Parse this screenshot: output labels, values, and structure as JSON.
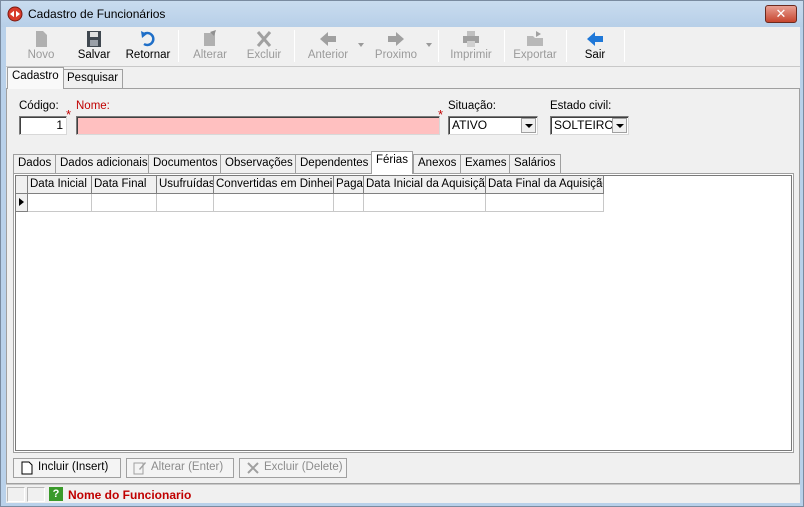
{
  "window": {
    "title": "Cadastro de Funcionários",
    "close_label": "✕"
  },
  "toolbar": {
    "novo": "Novo",
    "salvar": "Salvar",
    "retornar": "Retornar",
    "alterar": "Alterar",
    "excluir": "Excluir",
    "anterior": "Anterior",
    "proximo": "Proximo",
    "imprimir": "Imprimir",
    "exportar": "Exportar",
    "sair": "Sair"
  },
  "main_tabs": {
    "cadastro": "Cadastro",
    "pesquisar": "Pesquisar"
  },
  "form": {
    "codigo_label": "Código:",
    "codigo_value": "1",
    "nome_label": "Nome:",
    "nome_value": "",
    "required_mark": "*",
    "situacao_label": "Situação:",
    "situacao_value": "ATIVO",
    "estado_civil_label": "Estado civil:",
    "estado_civil_value": "SOLTEIRO"
  },
  "sub_tabs": {
    "dados": "Dados",
    "dados_adicionais": "Dados adicionais",
    "documentos": "Documentos",
    "observacoes": "Observações",
    "dependentes": "Dependentes",
    "ferias": "Férias",
    "anexos": "Anexos",
    "exames": "Exames",
    "salarios": "Salários"
  },
  "grid": {
    "columns": {
      "data_inicial": "Data Inicial",
      "data_final": "Data Final",
      "usufruidas": "Usufruídas",
      "convertidas": "Convertidas em Dinheiro",
      "paga": "Paga",
      "data_inicial_aquisicao": "Data Inicial da Aquisição",
      "data_final_aquisicao": "Data Final da Aquisição"
    }
  },
  "bottom_buttons": {
    "incluir": "Incluir (Insert)",
    "alterar": "Alterar (Enter)",
    "excluir": "Excluir (Delete)"
  },
  "status": {
    "help_icon": "?",
    "text": "Nome do Funcionario"
  },
  "colors": {
    "accent_required": "#c00000",
    "name_field_bg": "#ffc0c0",
    "titlebar": "#b9d1ea"
  }
}
